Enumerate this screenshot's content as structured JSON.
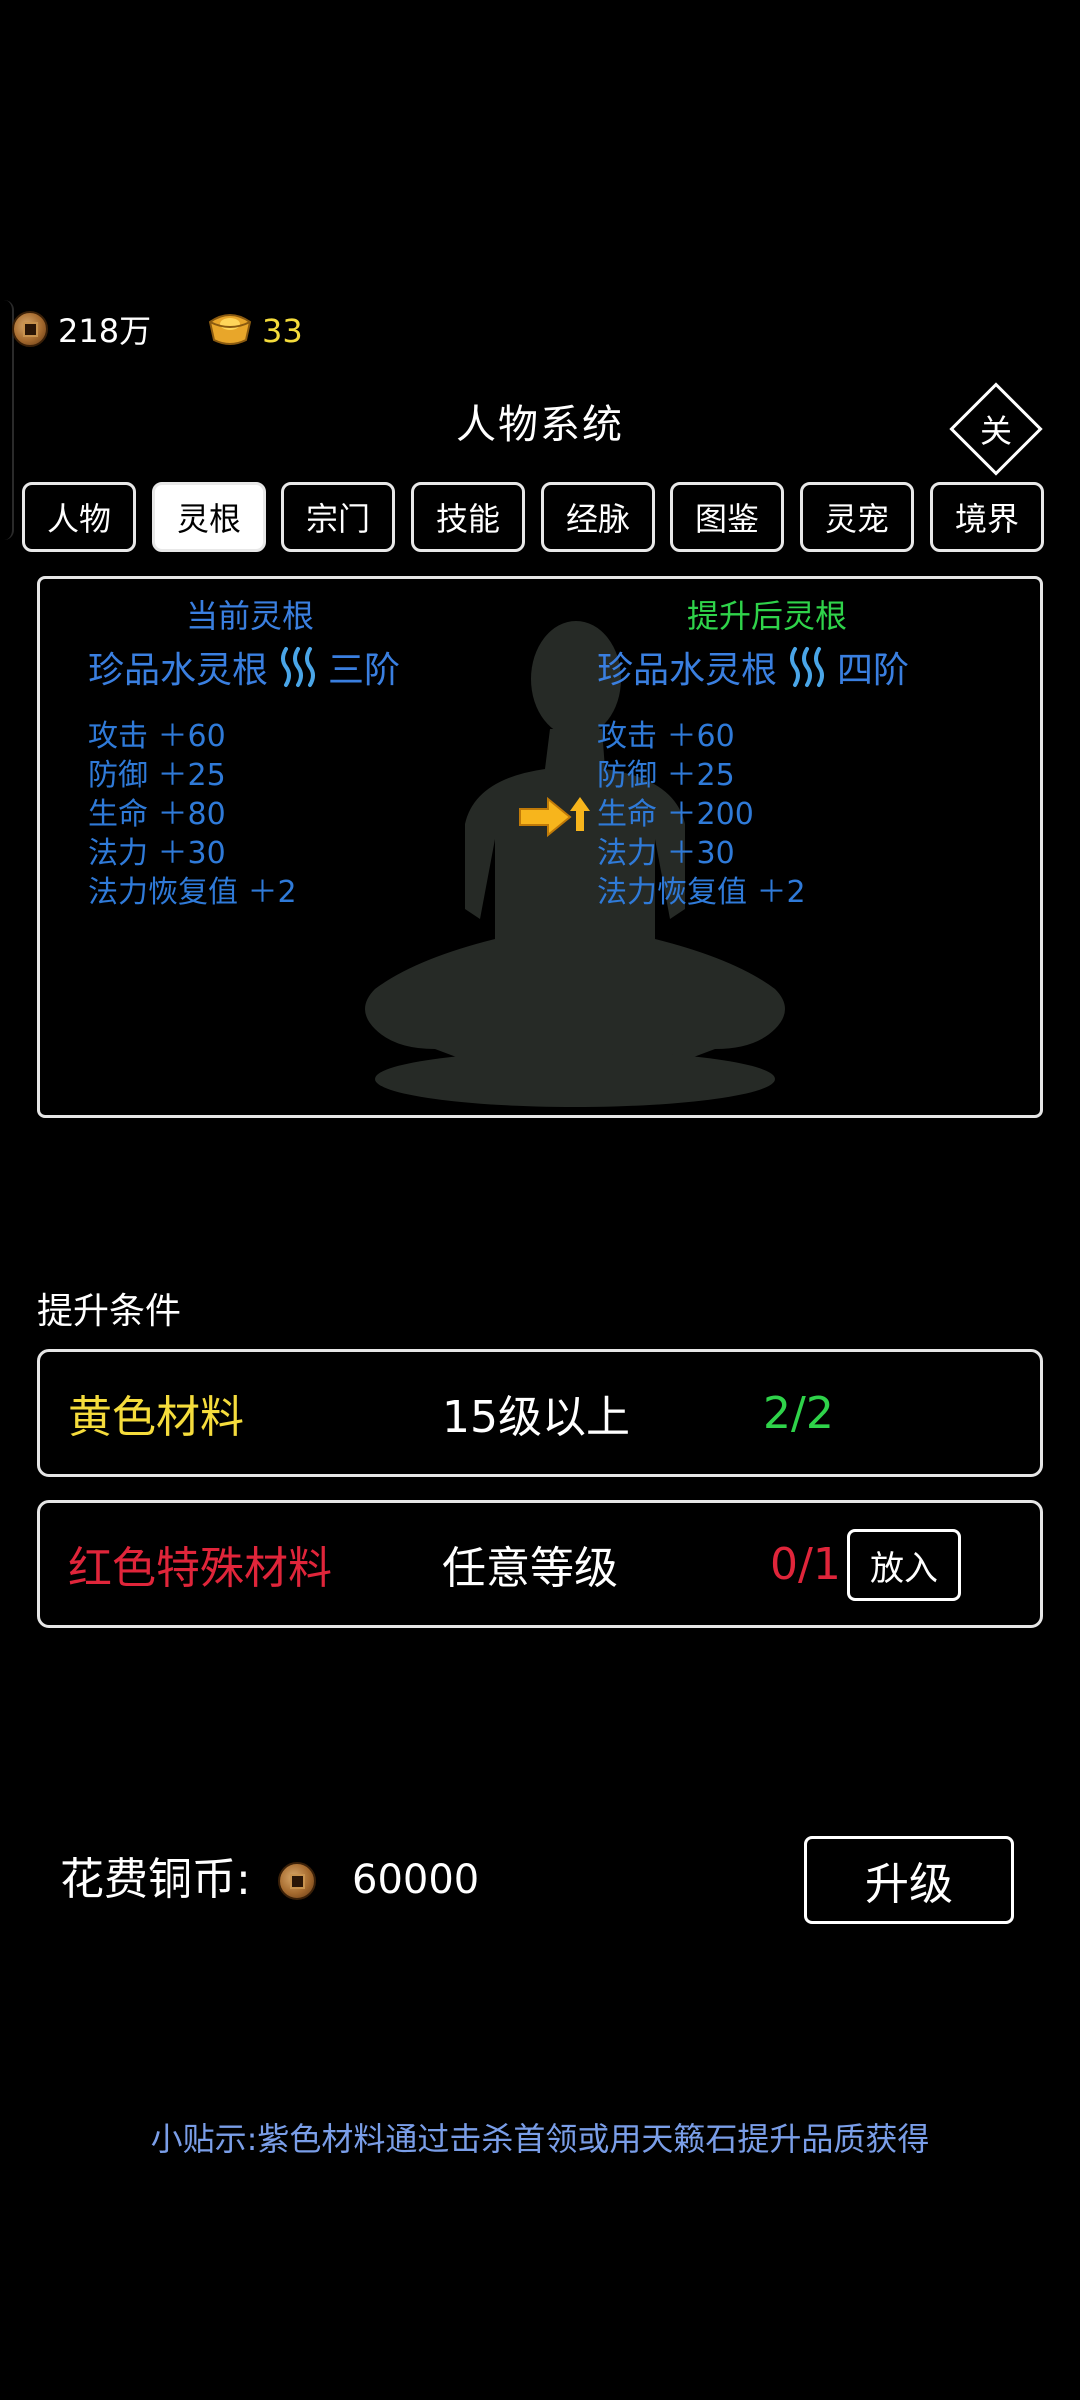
{
  "currency": {
    "copper_icon": "copper-coin-icon",
    "copper_amount": "218万",
    "gold_icon": "gold-ingot-icon",
    "gold_amount": "33"
  },
  "header": {
    "title": "人物系统",
    "close_label": "关"
  },
  "tabs": [
    {
      "label": "人物",
      "active": false
    },
    {
      "label": "灵根",
      "active": true
    },
    {
      "label": "宗门",
      "active": false
    },
    {
      "label": "技能",
      "active": false
    },
    {
      "label": "经脉",
      "active": false
    },
    {
      "label": "图鉴",
      "active": false
    },
    {
      "label": "灵宠",
      "active": false
    },
    {
      "label": "境界",
      "active": false
    }
  ],
  "current_root": {
    "heading": "当前灵根",
    "name": "珍品水灵根",
    "element_icon": "water-element-icon",
    "tier": "三阶",
    "stats": [
      "攻击 ＋60",
      "防御 ＋25",
      "生命 ＋80",
      "法力 ＋30",
      "法力恢复值 ＋2"
    ]
  },
  "upgraded_root": {
    "heading": "提升后灵根",
    "name": "珍品水灵根",
    "element_icon": "water-element-icon",
    "tier": "四阶",
    "stats": [
      "攻击 ＋60",
      "防御 ＋25",
      "生命 ＋200",
      "法力 ＋30",
      "法力恢复值 ＋2"
    ]
  },
  "conditions": {
    "label": "提升条件",
    "items": [
      {
        "material": "黄色材料",
        "requirement": "15级以上",
        "progress": "2/2"
      },
      {
        "material": "红色特殊材料",
        "requirement": "任意等级",
        "progress": "0/1",
        "action": "放入"
      }
    ]
  },
  "cost": {
    "label": "花费铜币:",
    "amount": "60000",
    "upgrade_label": "升级"
  },
  "tip": "小贴示:紫色材料通过击杀首领或用天籁石提升品质获得",
  "colors": {
    "blue_text": "#2f7ad8",
    "green_text": "#2fd34a",
    "yellow_text": "#f5dc3c",
    "red_text": "#e0253a",
    "tip_text": "#7a9ee8"
  }
}
